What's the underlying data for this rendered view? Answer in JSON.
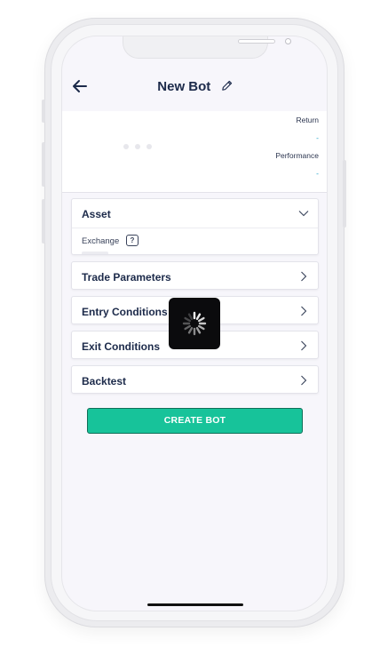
{
  "header": {
    "title": "New Bot",
    "back_icon": "arrow-left-icon",
    "edit_icon": "pencil-icon"
  },
  "stats": {
    "return_label": "Return",
    "return_value": "-",
    "performance_label": "Performance",
    "performance_value": "-"
  },
  "sections": {
    "asset": {
      "title": "Asset",
      "exchange_label": "Exchange",
      "help_label": "?"
    },
    "trade_parameters": {
      "title": "Trade Parameters"
    },
    "entry_conditions": {
      "title": "Entry Conditions"
    },
    "exit_conditions": {
      "title": "Exit Conditions"
    },
    "backtest": {
      "title": "Backtest"
    }
  },
  "create_button": {
    "label": "CREATE BOT"
  },
  "colors": {
    "accent": "#17c39a",
    "title_text": "#1c2a4a",
    "stat_value": "#1aa0c8"
  }
}
